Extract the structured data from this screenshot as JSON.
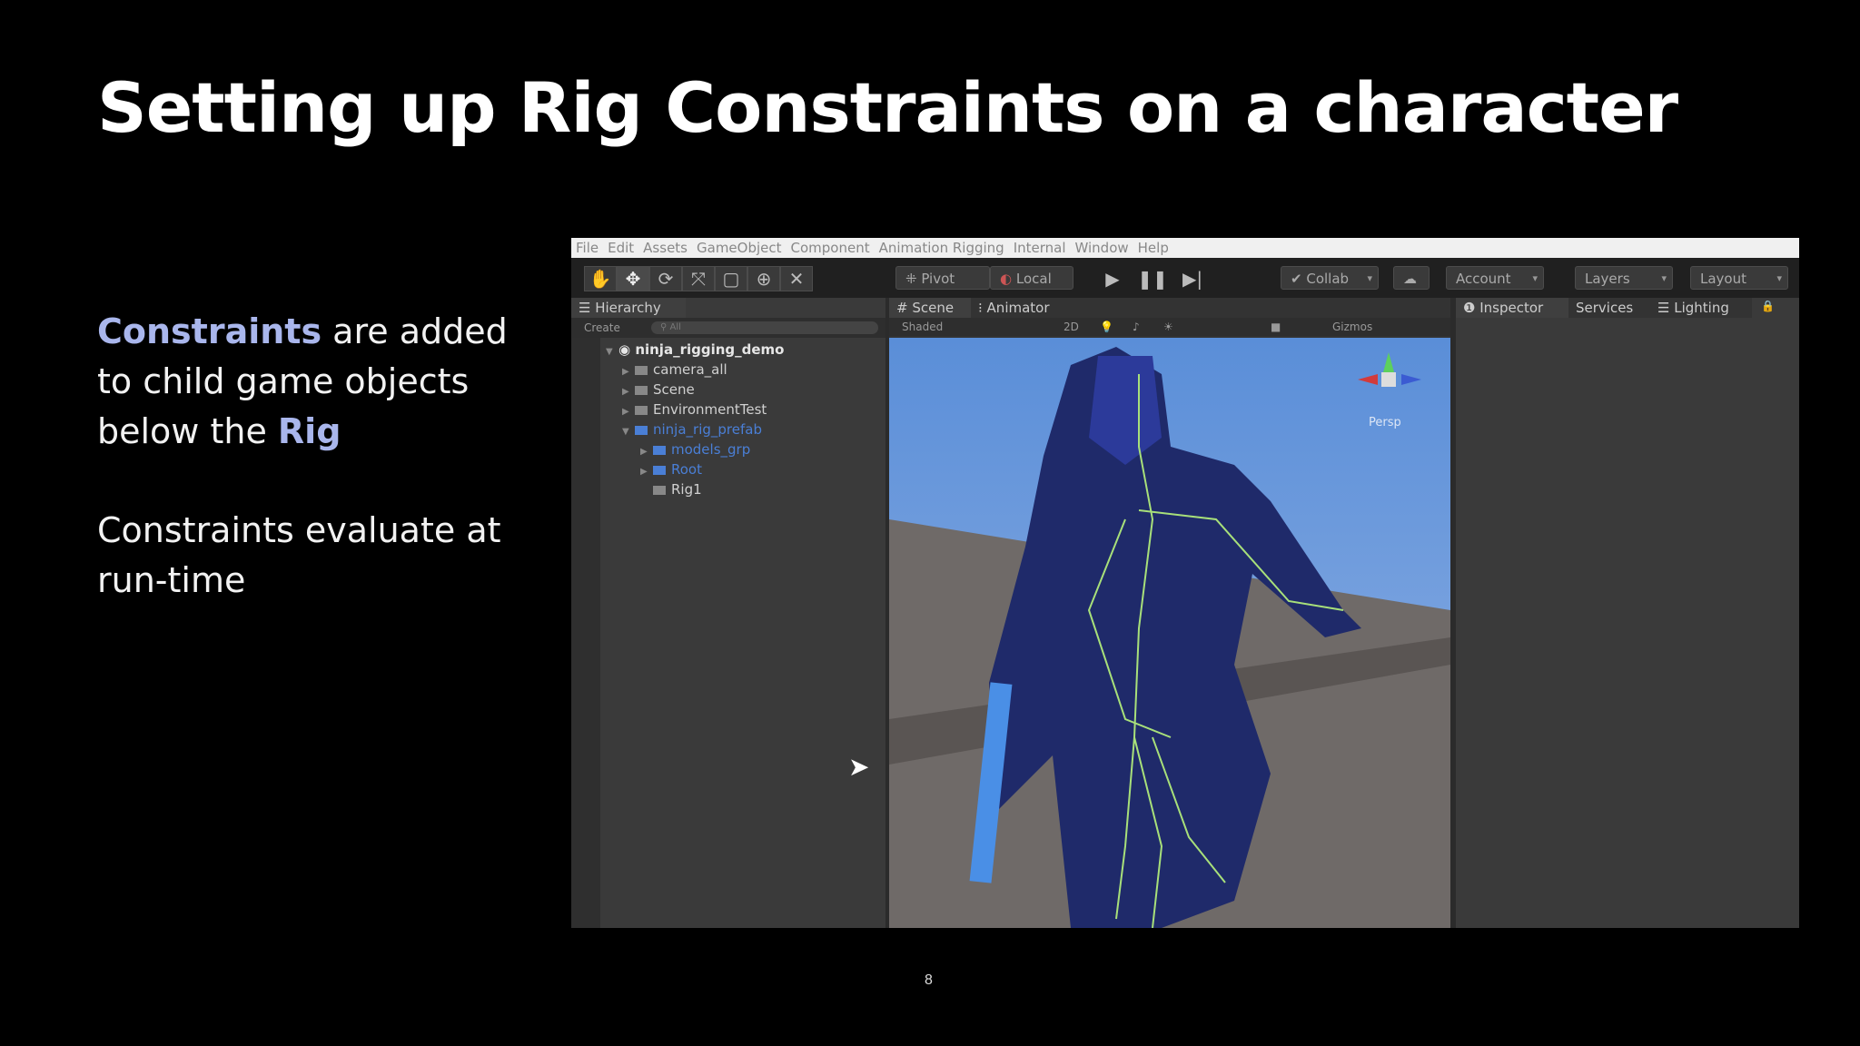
{
  "slide": {
    "title": "Setting up Rig Constraints on a character",
    "bullet1": {
      "hl1": "Constraints",
      "t1": " are added to child game objects below the ",
      "hl2": "Rig"
    },
    "bullet2": "Constraints evaluate at run-time",
    "page_number": "8",
    "accent_color": "#a9b6ec"
  },
  "unity": {
    "menu": [
      "File",
      "Edit",
      "Assets",
      "GameObject",
      "Component",
      "Animation Rigging",
      "Internal",
      "Window",
      "Help"
    ],
    "toolbar": {
      "tools": [
        "hand-icon",
        "move-icon",
        "rotate-icon",
        "scale-icon",
        "rect-icon",
        "transform-icon",
        "custom-tool-icon"
      ],
      "pivot": "Pivot",
      "local": "Local",
      "collab": "Collab",
      "account": "Account",
      "layers": "Layers",
      "layout": "Layout"
    },
    "hierarchy": {
      "tab": "Hierarchy",
      "create": "Create",
      "search_placeholder": "All",
      "root": "ninja_rigging_demo",
      "items": [
        "camera_all",
        "Scene",
        "EnvironmentTest",
        "ninja_rig_prefab",
        "models_grp",
        "Root",
        "Rig1"
      ]
    },
    "scene": {
      "tab_scene": "Scene",
      "tab_animator": "Animator",
      "shading": "Shaded",
      "mode_2d": "2D",
      "gizmos": "Gizmos",
      "persp": "Persp"
    },
    "inspector": {
      "tab_inspector": "Inspector",
      "tab_services": "Services",
      "tab_lighting": "Lighting"
    }
  }
}
